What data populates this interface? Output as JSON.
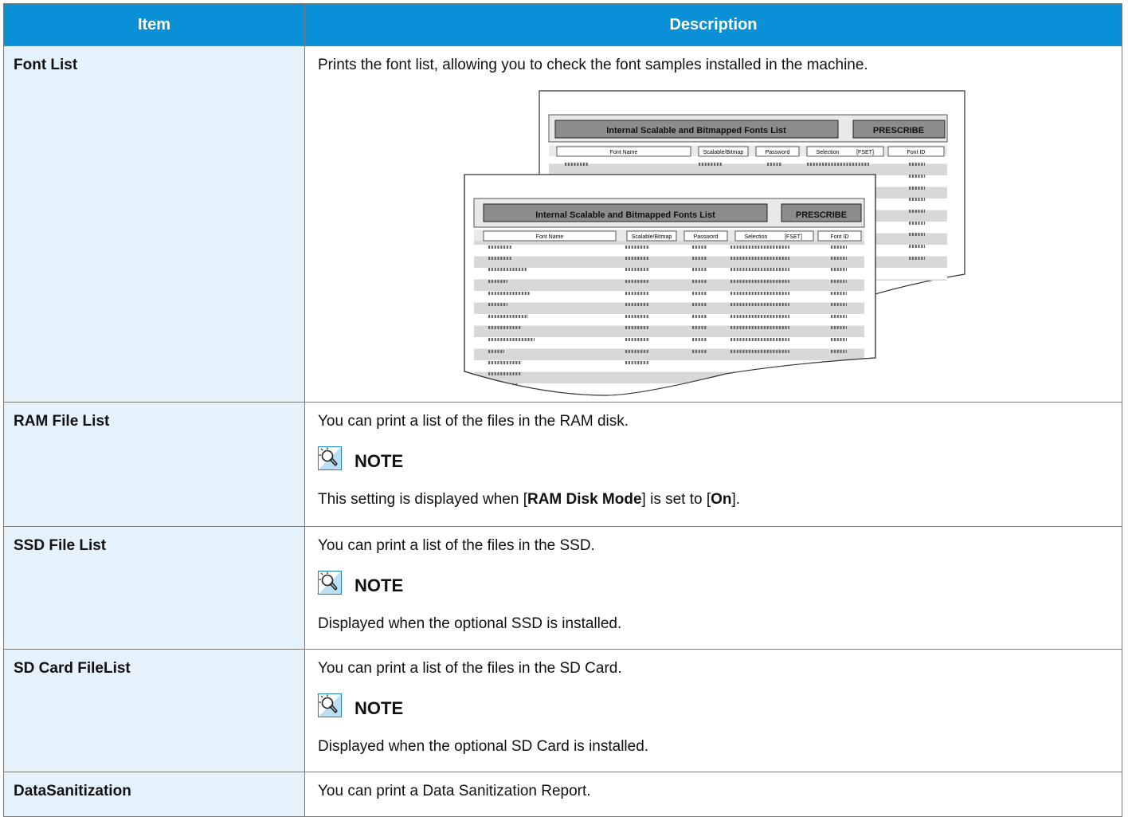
{
  "header": {
    "item": "Item",
    "description": "Description"
  },
  "rows": [
    {
      "item": "Font List",
      "desc": "Prints the font list, allowing you to check the font samples installed in the machine.",
      "illustration": {
        "title": "Internal Scalable and Bitmapped Fonts List",
        "brand": "PRESCRIBE",
        "columns": [
          "Font Name",
          "Scalable/Bitmap",
          "Password",
          "Selection",
          "[FSET]",
          "Font ID"
        ]
      }
    },
    {
      "item": "RAM File List",
      "desc": "You can print a list of the files in the RAM disk.",
      "note_label": "NOTE",
      "note_pre": "This setting is displayed when [",
      "note_b1": "RAM Disk Mode",
      "note_mid": "] is set to [",
      "note_b2": "On",
      "note_post": "]."
    },
    {
      "item": "SSD File List",
      "desc": "You can print a list of the files in the SSD.",
      "note_label": "NOTE",
      "note": "Displayed when the optional SSD is installed."
    },
    {
      "item": "SD Card FileList",
      "desc": "You can print a list of the files in the SD Card.",
      "note_label": "NOTE",
      "note": "Displayed when the optional SD Card is installed."
    },
    {
      "item": "DataSanitization",
      "desc": "You can print a Data Sanitization Report."
    }
  ],
  "colors": {
    "header_bg": "#0a90d7",
    "item_bg": "#e5f1fb",
    "border": "#7a7a7a"
  },
  "icons": {
    "note": "lightbulb-note-icon"
  }
}
